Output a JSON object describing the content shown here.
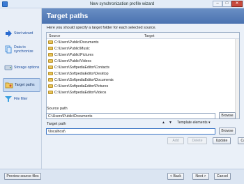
{
  "window": {
    "title": "New synchronization profile wizard",
    "min_symbol": "–",
    "max_symbol": "□",
    "close_symbol": "✕"
  },
  "sidebar": {
    "items": [
      {
        "label": "Start wizard",
        "icon": "arrow-right-icon",
        "color": "#2a6bd0"
      },
      {
        "label": "Data to synchronize",
        "icon": "documents-icon",
        "color": "#4a90d9"
      },
      {
        "label": "Storage options",
        "icon": "disk-icon",
        "color": "#7f9bbf"
      },
      {
        "label": "Target paths",
        "icon": "folder-target-icon",
        "color": "#e0b84a",
        "active": true
      },
      {
        "label": "File filter",
        "icon": "funnel-icon",
        "color": "#3aa0e0"
      }
    ]
  },
  "header": {
    "title": "Target paths"
  },
  "instruction": "Here you should specify a target folder for each selected source.",
  "source_table": {
    "columns": [
      "Source",
      "Target"
    ],
    "rows": [
      "C:\\Users\\Public\\Documents",
      "C:\\Users\\Public\\Music",
      "C:\\Users\\Public\\Pictures",
      "C:\\Users\\Public\\Videos",
      "C:\\Users\\SoftpediaEditor\\Contacts",
      "C:\\Users\\SoftpediaEditor\\Desktop",
      "C:\\Users\\SoftpediaEditor\\Documents",
      "C:\\Users\\SoftpediaEditor\\Pictures",
      "C:\\Users\\SoftpediaEditor\\Videos"
    ]
  },
  "source_path": {
    "label": "Source path",
    "value": "C:\\Users\\Public\\Documents",
    "browse_label": "Browse"
  },
  "target_path": {
    "label": "Target path",
    "value": "\\\\localhost\\",
    "browse_label": "Browse",
    "up_arrow": "▲",
    "down_arrow": "▼",
    "template_label": "Template elements",
    "template_caret": "▾"
  },
  "actions": {
    "add": "Add",
    "delete": "Delete",
    "update": "Update",
    "cancel": "Cancel"
  },
  "footer": {
    "preview": "Preview source files",
    "back": "< Back",
    "next": "Next >",
    "cancel": "Cancel"
  }
}
